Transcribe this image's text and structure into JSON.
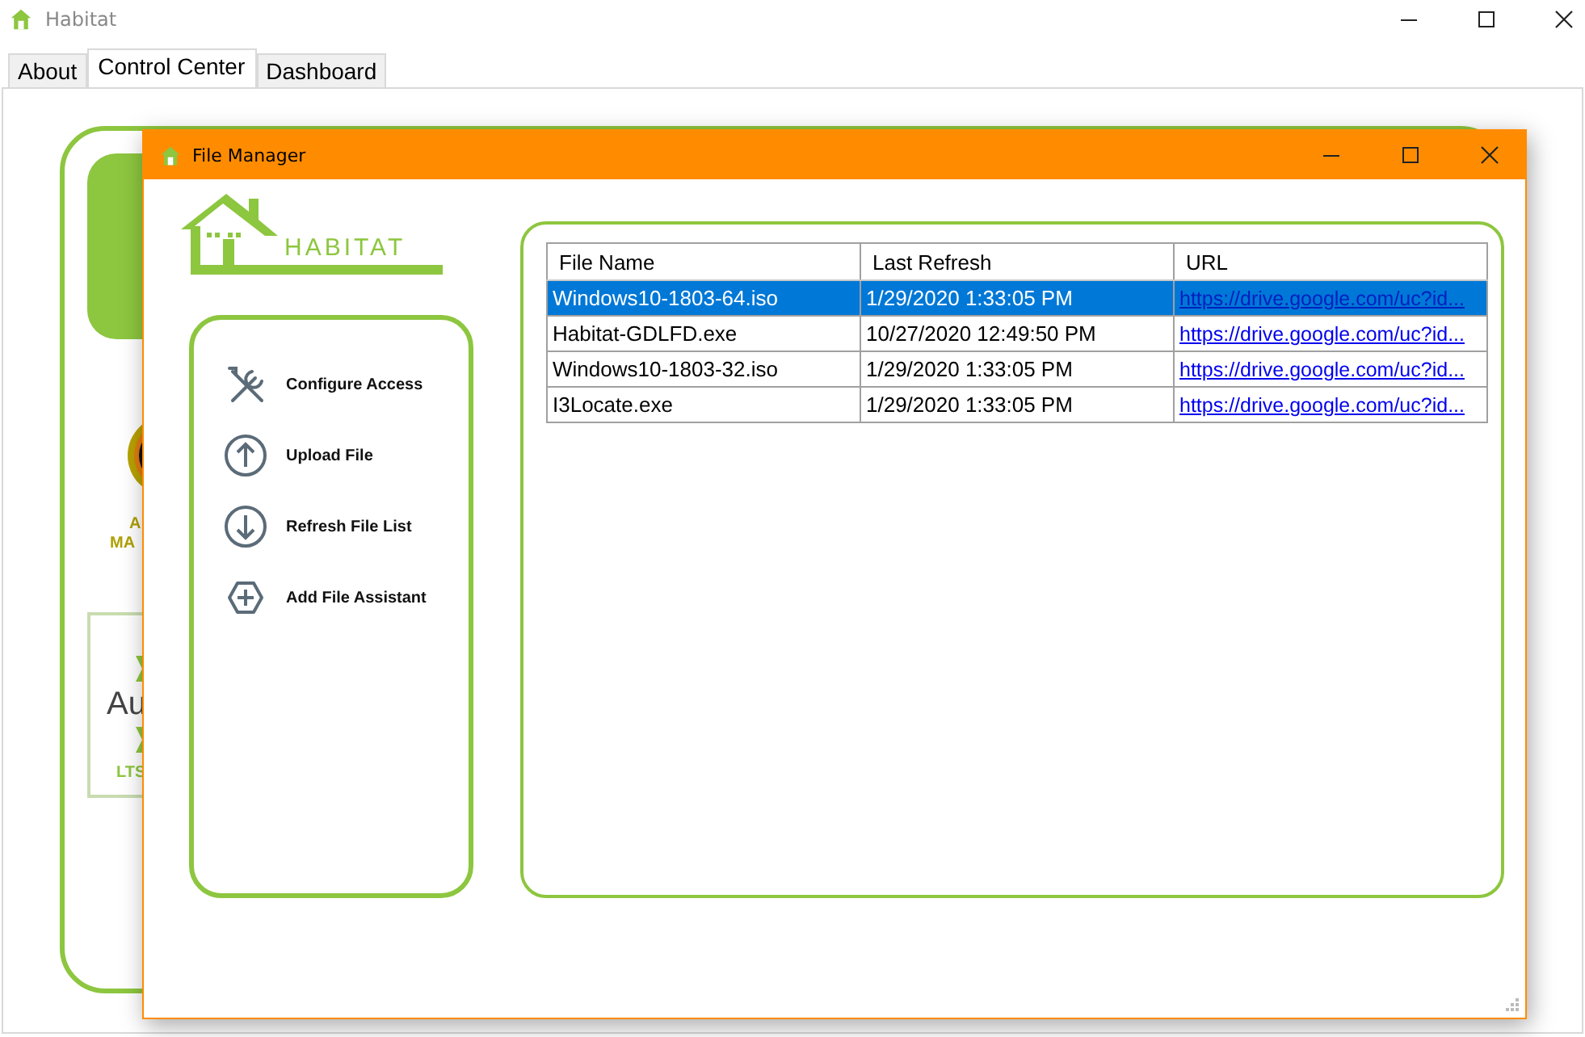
{
  "window": {
    "title": "Habitat"
  },
  "tabs": [
    {
      "label": "About",
      "selected": false
    },
    {
      "label": "Control Center",
      "selected": true
    },
    {
      "label": "Dashboard",
      "selected": false
    }
  ],
  "control_center": {
    "app_label_lines": [
      "A",
      "MA"
    ],
    "box_label": "Au",
    "box_caption": "LTS"
  },
  "file_manager": {
    "title": "File Manager",
    "logo_text": "HABITAT",
    "actions": [
      {
        "kind": "tools",
        "label": "Configure Access"
      },
      {
        "kind": "upload",
        "label": "Upload File"
      },
      {
        "kind": "download",
        "label": "Refresh File List"
      },
      {
        "kind": "add",
        "label": "Add File Assistant"
      }
    ],
    "table": {
      "columns": [
        "File Name",
        "Last Refresh",
        "URL"
      ],
      "rows": [
        {
          "selected": true,
          "cells": [
            "Windows10-1803-64.iso",
            "1/29/2020 1:33:05 PM",
            "https://drive.google.com/uc?id..."
          ]
        },
        {
          "selected": false,
          "cells": [
            "Habitat-GDLFD.exe",
            "10/27/2020 12:49:50 PM",
            "https://drive.google.com/uc?id..."
          ]
        },
        {
          "selected": false,
          "cells": [
            "Windows10-1803-32.iso",
            "1/29/2020 1:33:05 PM",
            "https://drive.google.com/uc?id..."
          ]
        },
        {
          "selected": false,
          "cells": [
            "I3Locate.exe",
            "1/29/2020 1:33:05 PM",
            "https://drive.google.com/uc?id..."
          ]
        }
      ]
    }
  }
}
